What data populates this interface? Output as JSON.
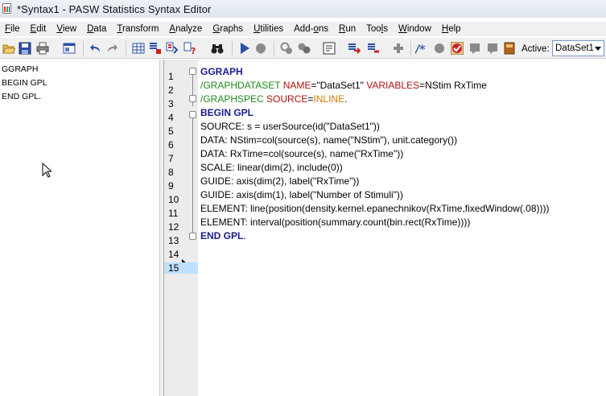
{
  "window": {
    "title": "*Syntax1 - PASW Statistics Syntax Editor"
  },
  "menu": [
    {
      "label": "File",
      "ul": "F",
      "rest": "ile"
    },
    {
      "label": "Edit",
      "ul": "E",
      "rest": "dit"
    },
    {
      "label": "View",
      "ul": "V",
      "rest": "iew"
    },
    {
      "label": "Data",
      "ul": "D",
      "rest": "ata"
    },
    {
      "label": "Transform",
      "ul": "T",
      "rest": "ransform"
    },
    {
      "label": "Analyze",
      "ul": "A",
      "rest": "nalyze"
    },
    {
      "label": "Graphs",
      "ul": "G",
      "rest": "raphs"
    },
    {
      "label": "Utilities",
      "ul": "U",
      "rest": "tilities"
    },
    {
      "label": "Add-ons",
      "pre": "Add-",
      "ul": "o",
      "rest": "ns"
    },
    {
      "label": "Run",
      "ul": "R",
      "rest": "un"
    },
    {
      "label": "Tools",
      "pre": "Too",
      "ul": "l",
      "rest": "s"
    },
    {
      "label": "Window",
      "ul": "W",
      "rest": "indow"
    },
    {
      "label": "Help",
      "ul": "H",
      "rest": "elp"
    }
  ],
  "toolbar": {
    "active_label": "Active:",
    "active_dataset": "DataSet1",
    "icons": [
      "open-folder-icon",
      "save-icon",
      "print-icon",
      "dialog-recall-icon",
      "undo-icon",
      "redo-icon",
      "go-to-data-icon",
      "go-to-case-icon",
      "variables-icon",
      "binoculars-find-icon",
      "run-selection-icon",
      "stop-icon",
      "breakpoint-icon",
      "bookmark-icon",
      "syntax-help-icon",
      "goto-error-icon",
      "expand-icon",
      "comment-icon",
      "toggle-breakpoint-icon",
      "validation-icon",
      "clear-icon",
      "cursor-icon",
      "next-icon",
      "book-icon"
    ]
  },
  "outline": [
    "GGRAPH",
    "BEGIN GPL",
    "END GPL."
  ],
  "editor": {
    "line_numbers": [
      "1",
      "2",
      "3",
      "4",
      "5",
      "6",
      "7",
      "8",
      "9",
      "10",
      "11",
      "12",
      "13",
      "14",
      "15"
    ],
    "current_line": 15,
    "lines": [
      [
        {
          "t": "GGRAPH",
          "c": "kw"
        }
      ],
      [
        {
          "t": "/GRAPHDATASET",
          "c": "sub"
        },
        {
          "t": " NAME",
          "c": "kwname"
        },
        {
          "t": "=\"DataSet1\"",
          "c": "val"
        },
        {
          "t": " VARIABLES",
          "c": "kwname"
        },
        {
          "t": "=NStim RxTime",
          "c": "val"
        }
      ],
      [
        {
          "t": "/GRAPHSPEC",
          "c": "sub"
        },
        {
          "t": " SOURCE",
          "c": "kwname"
        },
        {
          "t": "=",
          "c": "val"
        },
        {
          "t": "INLINE",
          "c": "lit"
        },
        {
          "t": ".",
          "c": "val"
        }
      ],
      [
        {
          "t": "BEGIN GPL",
          "c": "kw"
        }
      ],
      [
        {
          "t": "SOURCE: s = userSource(id(\"DataSet1\"))",
          "c": "val"
        }
      ],
      [
        {
          "t": "DATA: NStim=col(source(s), name(\"NStim\"), unit.category())",
          "c": "val"
        }
      ],
      [
        {
          "t": "DATA: RxTime=col(source(s), name(\"RxTime\"))",
          "c": "val"
        }
      ],
      [
        {
          "t": "SCALE: linear(dim(2), include(0))",
          "c": "val"
        }
      ],
      [
        {
          "t": "GUIDE: axis(dim(2), label(\"RxTime\"))",
          "c": "val"
        }
      ],
      [
        {
          "t": "GUIDE: axis(dim(1), label(\"Number of Stimuli\"))",
          "c": "val"
        }
      ],
      [
        {
          "t": "ELEMENT: line(position(density.kernel.epanechnikov(RxTime,fixedWindow(.08))))",
          "c": "val"
        }
      ],
      [
        {
          "t": "ELEMENT: interval(position(summary.count(bin.rect(RxTime))))",
          "c": "val"
        }
      ],
      [
        {
          "t": "END GPL",
          "c": "kw"
        },
        {
          "t": ".",
          "c": "val"
        }
      ],
      [],
      []
    ]
  }
}
